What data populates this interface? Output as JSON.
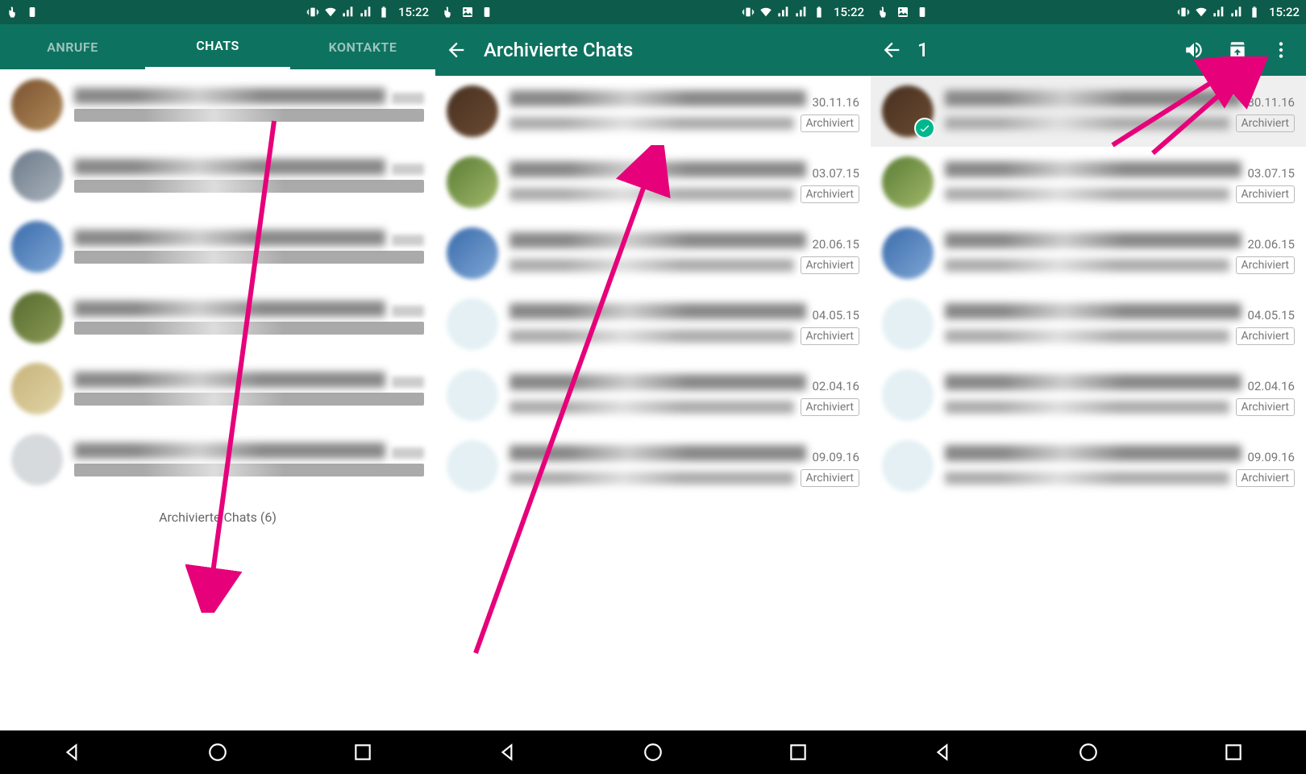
{
  "status": {
    "time": "15:22"
  },
  "screen1": {
    "tabs": [
      "ANRUFE",
      "CHATS",
      "KONTAKTE"
    ],
    "active_tab": 1,
    "archived_link": "Archivierte Chats (6)"
  },
  "screen2": {
    "title": "Archivierte Chats",
    "rows": [
      {
        "date": "30.11.16",
        "badge": "Archiviert"
      },
      {
        "date": "03.07.15",
        "badge": "Archiviert"
      },
      {
        "date": "20.06.15",
        "badge": "Archiviert"
      },
      {
        "date": "04.05.15",
        "badge": "Archiviert"
      },
      {
        "date": "02.04.16",
        "badge": "Archiviert"
      },
      {
        "date": "09.09.16",
        "badge": "Archiviert"
      }
    ]
  },
  "screen3": {
    "selection_count": "1",
    "rows": [
      {
        "date": "30.11.16",
        "badge": "Archiviert",
        "selected": true
      },
      {
        "date": "03.07.15",
        "badge": "Archiviert"
      },
      {
        "date": "20.06.15",
        "badge": "Archiviert"
      },
      {
        "date": "04.05.15",
        "badge": "Archiviert"
      },
      {
        "date": "02.04.16",
        "badge": "Archiviert"
      },
      {
        "date": "09.09.16",
        "badge": "Archiviert"
      }
    ]
  }
}
